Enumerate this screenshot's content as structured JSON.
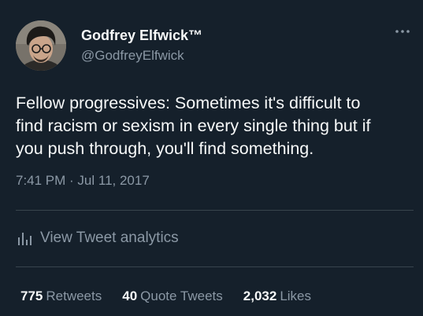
{
  "user": {
    "display_name": "Godfrey Elfwick™",
    "handle": "@GodfreyElfwick"
  },
  "tweet": {
    "text_lines": [
      "Fellow progressives: Sometimes it's difficult to",
      "find racism or sexism in every single thing but if",
      "you push through, you'll find something."
    ],
    "timestamp": "7:41 PM · Jul 11, 2017"
  },
  "analytics": {
    "label": "View Tweet analytics",
    "icon": "bar-chart-icon"
  },
  "stats": {
    "retweets_count": "775",
    "retweets_label": "Retweets",
    "quotes_count": "40",
    "quotes_label": "Quote Tweets",
    "likes_count": "2,032",
    "likes_label": "Likes"
  },
  "icons": {
    "more": "more-horizontal-icon"
  },
  "colors": {
    "background": "#15202b",
    "primary_text": "#f7f9f9",
    "secondary_text": "#8b98a5",
    "divider": "#38444d"
  }
}
